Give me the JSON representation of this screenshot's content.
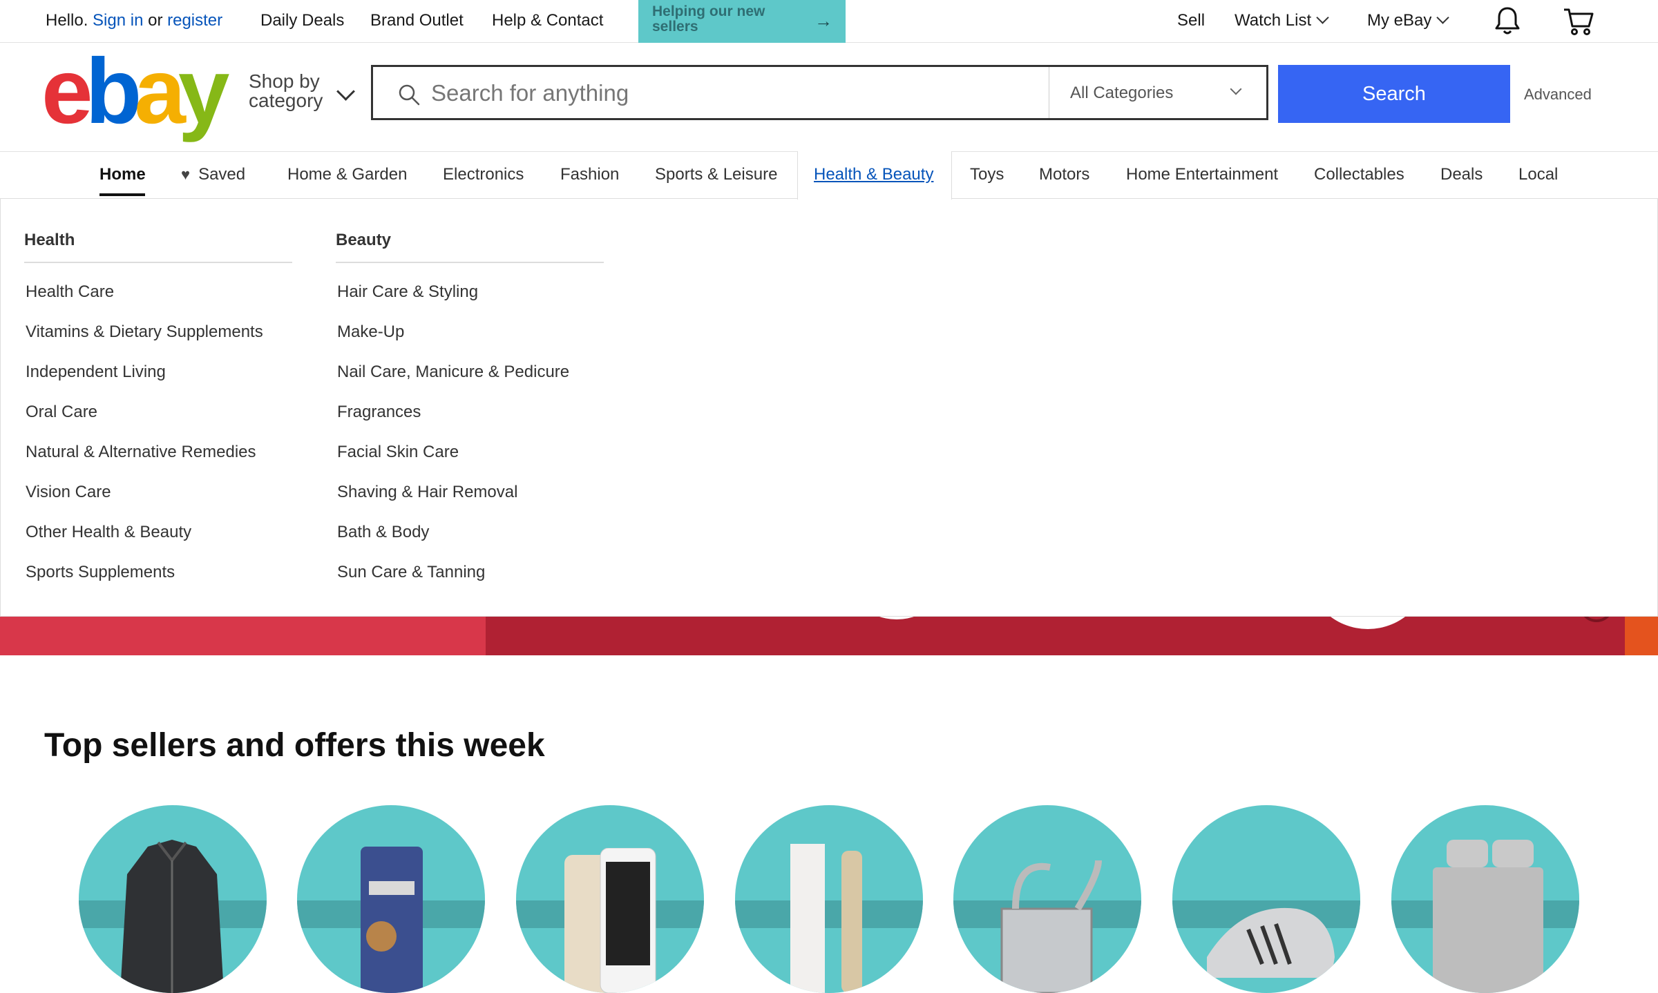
{
  "topbar": {
    "hello": "Hello.",
    "sign_in": "Sign in",
    "or": "or",
    "register": "register",
    "links": [
      "Daily Deals",
      "Brand Outlet",
      "Help & Contact"
    ],
    "promo": "Helping our new sellers",
    "sell": "Sell",
    "watch_list": "Watch List",
    "my_ebay": "My eBay"
  },
  "header": {
    "logo_letters": [
      "e",
      "b",
      "a",
      "y"
    ],
    "logo_colors": [
      "#e53238",
      "#0064d2",
      "#f5af02",
      "#86b817"
    ],
    "shop_by": "Shop by",
    "category": "category",
    "search_placeholder": "Search for anything",
    "category_select": "All Categories",
    "search_button": "Search",
    "advanced": "Advanced"
  },
  "nav": {
    "items": [
      "Home",
      "Saved",
      "Home & Garden",
      "Electronics",
      "Fashion",
      "Sports & Leisure",
      "Health & Beauty",
      "Toys",
      "Motors",
      "Home Entertainment",
      "Collectables",
      "Deals",
      "Local"
    ],
    "active": "Health & Beauty"
  },
  "dropdown": {
    "health": {
      "title": "Health",
      "links": [
        "Health Care",
        "Vitamins & Dietary Supplements",
        "Independent Living",
        "Oral Care",
        "Natural & Alternative Remedies",
        "Vision Care",
        "Other Health & Beauty",
        "Sports Supplements"
      ]
    },
    "beauty": {
      "title": "Beauty",
      "links": [
        "Hair Care & Styling",
        "Make-Up",
        "Nail Care, Manicure & Pedicure",
        "Fragrances",
        "Facial Skin Care",
        "Shaving & Hair Removal",
        "Bath & Body",
        "Sun Care & Tanning"
      ]
    }
  },
  "section": {
    "title": "Top sellers and offers this week",
    "circles": [
      "jacket",
      "dog-treats",
      "phones",
      "cosmetics",
      "radiator",
      "sneakers",
      "bedding"
    ]
  },
  "colors": {
    "accent": "#3665f3",
    "link": "#0654ba",
    "teal": "#5ec8c9"
  }
}
